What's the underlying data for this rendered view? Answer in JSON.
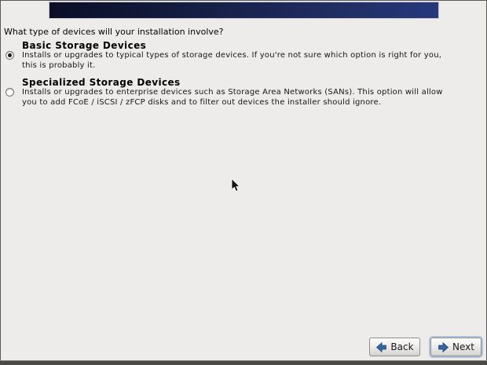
{
  "window": {
    "question": "What type of devices will your installation involve?"
  },
  "options": [
    {
      "title": "Basic Storage Devices",
      "description_lines": [
        "Installs or upgrades to typical types of storage devices.  If you're not sure which option is right for you,",
        "this is probably it."
      ],
      "selected": true
    },
    {
      "title": "Specialized Storage Devices",
      "description_lines": [
        "Installs or upgrades to enterprise devices such as Storage Area Networks (SANs). This option will allow",
        "you to add FCoE / iSCSI / zFCP disks and to filter out devices the installer should ignore."
      ],
      "selected": false
    }
  ],
  "footer": {
    "back_label": "Back",
    "next_label": "Next"
  },
  "icons": {
    "back_button": "blue-arrow-left-icon",
    "next_button": "blue-arrow-right-icon",
    "radio_selected": "radio-filled",
    "radio_unselected": "radio-empty",
    "pointer": "mouse-arrow-cursor"
  },
  "colors": {
    "background": "#edecea",
    "banner_gradient_left": "#0a0e26",
    "banner_gradient_right": "#26377e",
    "arrow_blue": "#36679f",
    "arrow_blue_dark": "#1f4a7c",
    "bottom_bar": "#4b4a47"
  }
}
